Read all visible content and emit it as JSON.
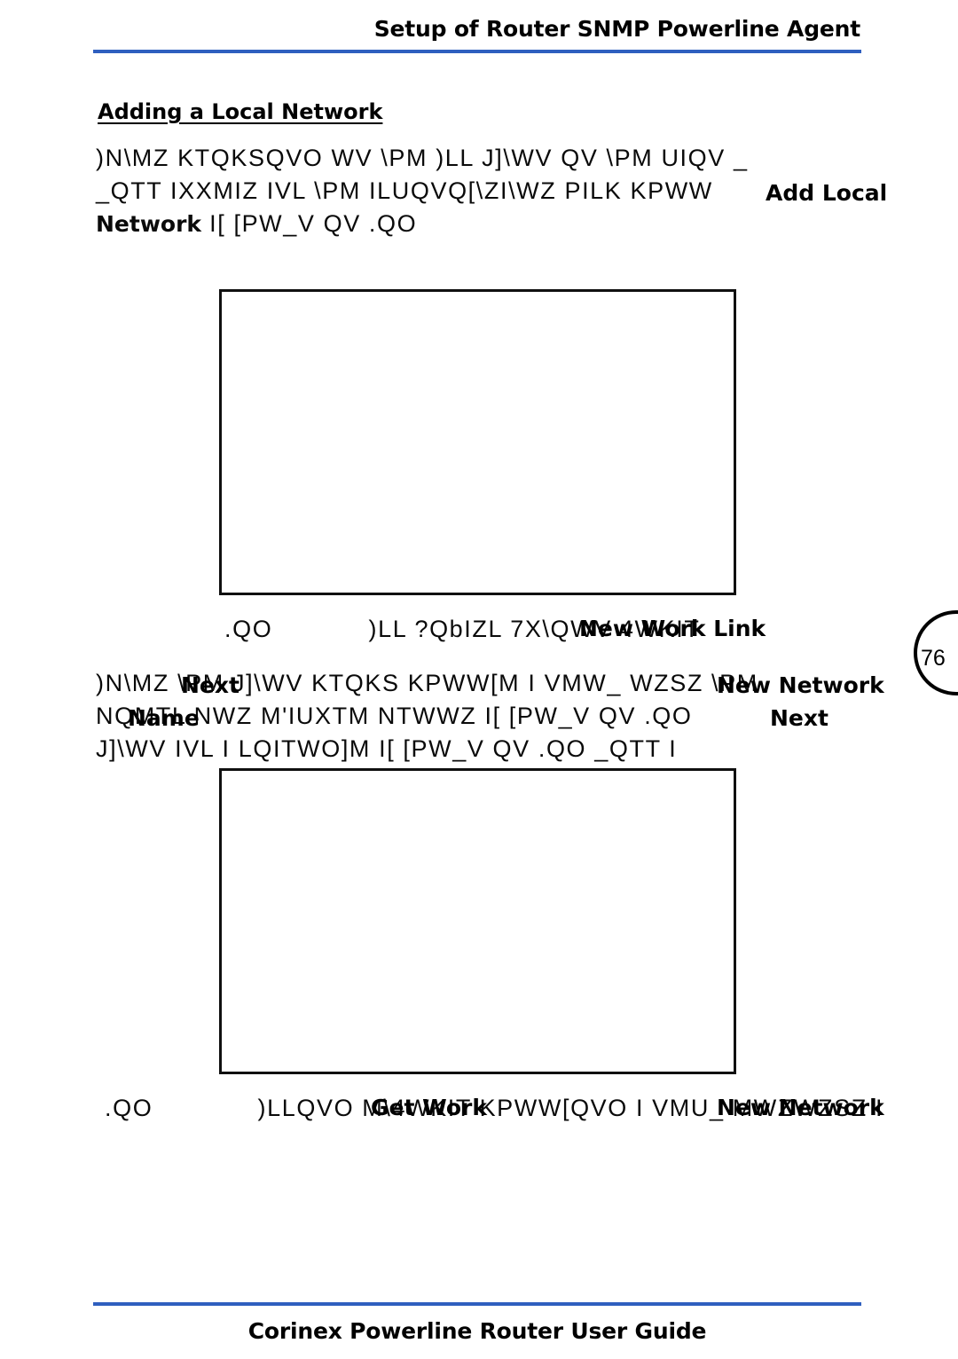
{
  "document": {
    "header_title": "Setup of Router SNMP Powerline Agent",
    "footer_title": "Corinex Powerline Router User Guide",
    "page_number": "76",
    "rule_color": "#2f5fbf"
  },
  "section": {
    "heading": "Adding a Local Network"
  },
  "paragraph1": {
    "line1": ")N\\MZ KTQKSQVO WV \\PM )LL J]\\WV QV \\PM UIQV _",
    "line2_pre": "_QTT IXXMIZ IVL \\PM ILUQVQ[\\ZI\\WZ ",
    "line2_cipher_tail": "PILK KPWW",
    "line2_overprint": "Add Local",
    "line3_bold": "Network",
    "line3_rest": " I[ [PW_V QV .QO"
  },
  "figure1": {
    "caption_pre": ".QO",
    "caption_cipher": ")LL ?QbIZL 7X\\QWV 4WKIT",
    "caption_overprint": "New Work Link",
    "caption_tail": "4WKIT"
  },
  "paragraph2": {
    "line1_cipher": ")N\\MZ \\PM J]\\WV KTQKS KPWW[M I VMW_ WZSZ \\PM",
    "line1_overprint1": "Next",
    "line1_overprint2": "New Network",
    "line2_cipher": "NQMTL NWZ M'IUXTM NTWWZ I[ [PW_V QV .QO",
    "line2_overprint1": "Name",
    "line2_overprint2": "Next",
    "line3_cipher": "J]\\WV IVL I LQITWO]M I[ [PW_V QV .QO          _QTT I"
  },
  "figure2": {
    "caption_pre": ".QO",
    "caption_cipher": ")LLQVO M\\4WKIT KPWW[QVO I VMU_ MWZWZSZ I",
    "caption_overprint1": "Get Work",
    "caption_overprint2": "New Network"
  }
}
